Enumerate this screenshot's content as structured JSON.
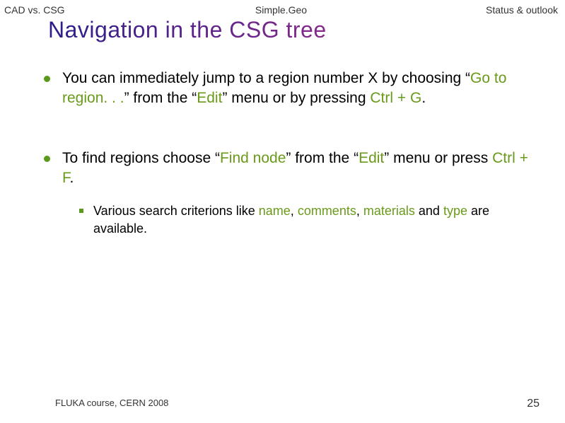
{
  "tabs": {
    "left": "CAD vs. CSG",
    "center": "Simple.Geo",
    "right": "Status & outlook"
  },
  "title": "Navigation in the CSG tree",
  "bullets": {
    "b1": {
      "p1": "You can immediately jump to a region number X by choosing “",
      "k1": "Go to region. . .",
      "p2": "” from the “",
      "k2": "Edit",
      "p3": "” menu or by pressing ",
      "k3": "Ctrl + G",
      "p4": "."
    },
    "b2": {
      "p1": "To find regions choose “",
      "k1": "Find node",
      "p2": "” from the “",
      "k2": "Edit",
      "p3": "” menu or press ",
      "k3": "Ctrl + F",
      "p4": "."
    },
    "sub1": {
      "p1": "Various search criterions like ",
      "k1": "name",
      "c1": ", ",
      "k2": "comments",
      "c2": ", ",
      "k3": "materials",
      "p2": " and ",
      "k4": "type",
      "p3": " are available."
    }
  },
  "footer": {
    "left": "FLUKA course, CERN 2008",
    "page": "25"
  }
}
